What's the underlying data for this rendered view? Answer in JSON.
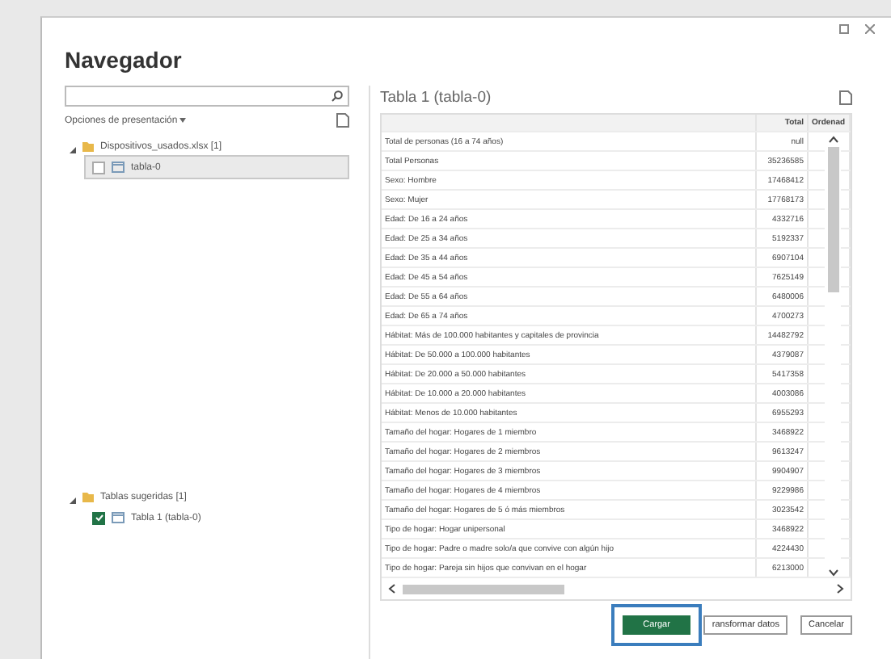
{
  "dialog": {
    "title": "Navegador"
  },
  "left_panel": {
    "display_options": "Opciones de presentación",
    "tree": [
      {
        "label": "Dispositivos_usados.xlsx [1]",
        "expanded": true,
        "children": [
          {
            "label": "tabla-0",
            "checked": false,
            "selected": true
          }
        ]
      },
      {
        "label": "Tablas sugeridas [1]",
        "expanded": true,
        "children": [
          {
            "label": "Tabla 1 (tabla-0)",
            "checked": true,
            "selected": false
          }
        ]
      }
    ]
  },
  "preview": {
    "title": "Tabla 1 (tabla-0)",
    "columns": [
      "",
      "Total",
      "Ordenad"
    ],
    "rows": [
      [
        "Total de personas (16 a 74 años)",
        "null"
      ],
      [
        "Total Personas",
        "35236585"
      ],
      [
        "Sexo: Hombre",
        "17468412"
      ],
      [
        "Sexo: Mujer",
        "17768173"
      ],
      [
        "Edad: De 16 a 24 años",
        "4332716"
      ],
      [
        "Edad: De 25 a 34 años",
        "5192337"
      ],
      [
        "Edad: De 35 a 44 años",
        "6907104"
      ],
      [
        "Edad: De 45 a 54 años",
        "7625149"
      ],
      [
        "Edad: De 55 a 64 años",
        "6480006"
      ],
      [
        "Edad: De 65 a 74 años",
        "4700273"
      ],
      [
        "Hábitat: Más de 100.000 habitantes y capitales de provincia",
        "14482792"
      ],
      [
        "Hábitat: De 50.000 a 100.000 habitantes",
        "4379087"
      ],
      [
        "Hábitat: De 20.000 a 50.000 habitantes",
        "5417358"
      ],
      [
        "Hábitat: De 10.000 a 20.000 habitantes",
        "4003086"
      ],
      [
        "Hábitat: Menos de 10.000 habitantes",
        "6955293"
      ],
      [
        "Tamaño del hogar: Hogares de 1 miembro",
        "3468922"
      ],
      [
        "Tamaño del hogar: Hogares de 2 miembros",
        "9613247"
      ],
      [
        "Tamaño del hogar: Hogares de 3 miembros",
        "9904907"
      ],
      [
        "Tamaño del hogar: Hogares de 4 miembros",
        "9229986"
      ],
      [
        "Tamaño del hogar: Hogares de 5 ó más miembros",
        "3023542"
      ],
      [
        "Tipo de hogar: Hogar unipersonal",
        "3468922"
      ],
      [
        "Tipo de hogar: Padre o madre solo/a que convive con algún hijo",
        "4224430"
      ],
      [
        "Tipo de hogar: Pareja sin hijos que convivan en el hogar",
        "6213000"
      ]
    ]
  },
  "buttons": [
    {
      "label": "Cargar",
      "kind": "primary",
      "highlighted": true
    },
    {
      "label": "ransformar datos",
      "kind": "secondary",
      "highlighted": false
    },
    {
      "label": "Cancelar",
      "kind": "secondary",
      "highlighted": false
    }
  ]
}
